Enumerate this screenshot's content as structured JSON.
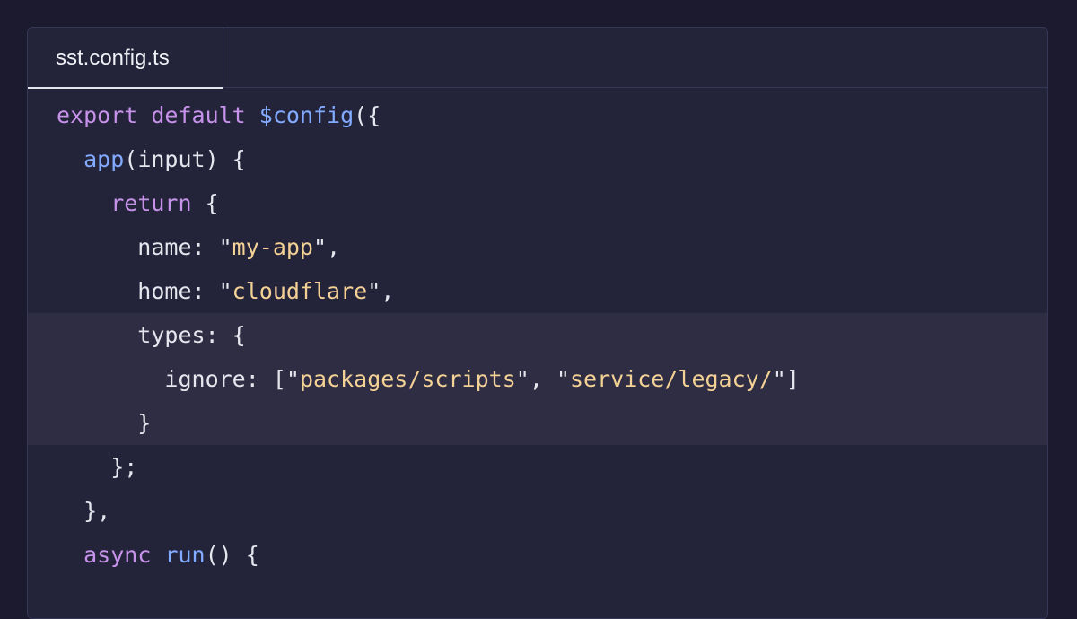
{
  "tab": {
    "label": "sst.config.ts"
  },
  "colors": {
    "background": "#1b1a2e",
    "panel": "#23233a",
    "highlight": "#2e2d44",
    "keyword": "#c792ea",
    "function": "#82aaff",
    "string": "#f4d195",
    "text": "#e6e6ee"
  },
  "code": {
    "highlighted_lines": [
      5,
      6,
      7
    ],
    "lines": [
      [
        {
          "k": "kw",
          "t": "export"
        },
        {
          "k": "pl",
          "t": " "
        },
        {
          "k": "kw",
          "t": "default"
        },
        {
          "k": "pl",
          "t": " "
        },
        {
          "k": "fn",
          "t": "$config"
        },
        {
          "k": "pl",
          "t": "({"
        }
      ],
      [
        {
          "k": "pl",
          "t": "  "
        },
        {
          "k": "fn",
          "t": "app"
        },
        {
          "k": "pl",
          "t": "(input) {"
        }
      ],
      [
        {
          "k": "pl",
          "t": "    "
        },
        {
          "k": "kw",
          "t": "return"
        },
        {
          "k": "pl",
          "t": " {"
        }
      ],
      [
        {
          "k": "pl",
          "t": "      name: \""
        },
        {
          "k": "str",
          "t": "my-app"
        },
        {
          "k": "pl",
          "t": "\","
        }
      ],
      [
        {
          "k": "pl",
          "t": "      home: \""
        },
        {
          "k": "str",
          "t": "cloudflare"
        },
        {
          "k": "pl",
          "t": "\","
        }
      ],
      [
        {
          "k": "pl",
          "t": "      types: {"
        }
      ],
      [
        {
          "k": "pl",
          "t": "        ignore: [\""
        },
        {
          "k": "str",
          "t": "packages/scripts"
        },
        {
          "k": "pl",
          "t": "\", \""
        },
        {
          "k": "str",
          "t": "service/legacy/"
        },
        {
          "k": "pl",
          "t": "\"]"
        }
      ],
      [
        {
          "k": "pl",
          "t": "      }"
        }
      ],
      [
        {
          "k": "pl",
          "t": "    };"
        }
      ],
      [
        {
          "k": "pl",
          "t": "  },"
        }
      ],
      [
        {
          "k": "pl",
          "t": "  "
        },
        {
          "k": "kw",
          "t": "async"
        },
        {
          "k": "pl",
          "t": " "
        },
        {
          "k": "fn",
          "t": "run"
        },
        {
          "k": "pl",
          "t": "() {"
        }
      ]
    ]
  }
}
